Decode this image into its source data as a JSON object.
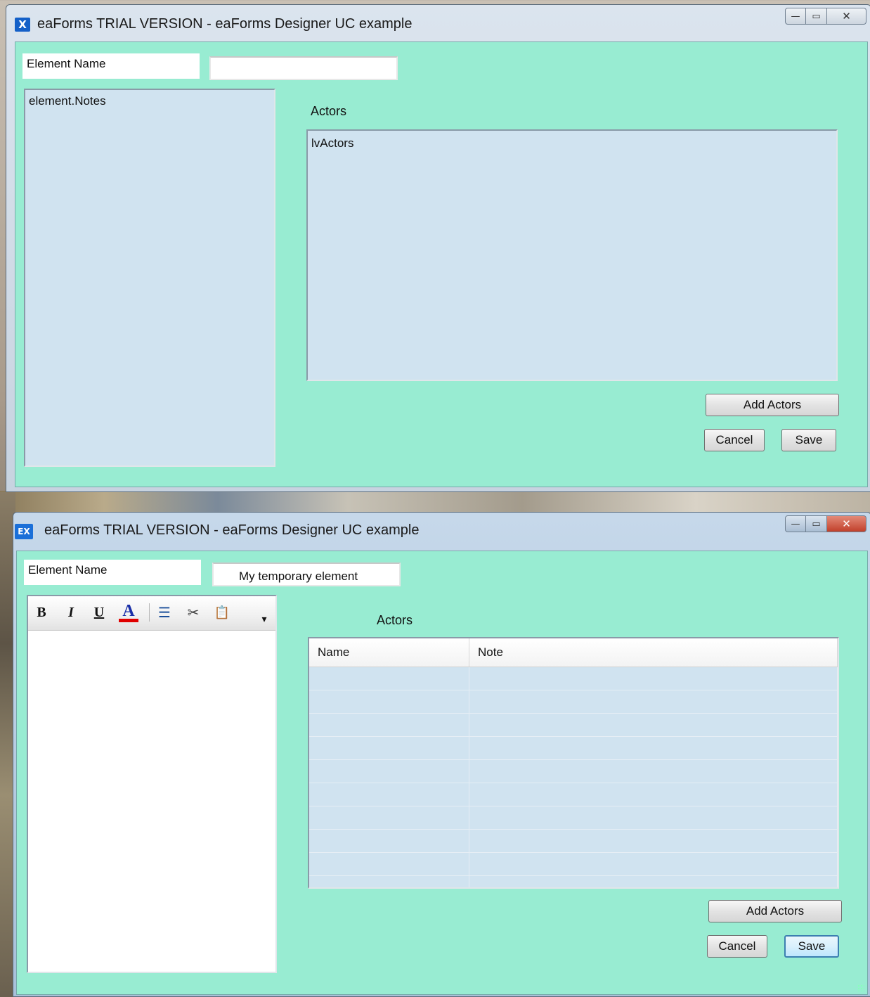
{
  "window1": {
    "title": "eaForms TRIAL VERSION - eaForms Designer UC example",
    "icon_text": "X",
    "caption": {
      "minimize": "—",
      "maximize": "▭",
      "close": "✕"
    },
    "element_name_label": "Element Name",
    "element_name_value": "",
    "notes_text": "element.Notes",
    "actors_label": "Actors",
    "actors_list_text": "lvActors",
    "add_actors_label": "Add Actors",
    "cancel_label": "Cancel",
    "save_label": "Save"
  },
  "window2": {
    "title": "eaForms TRIAL VERSION - eaForms Designer UC example",
    "icon_text": "EX",
    "caption": {
      "minimize": "—",
      "maximize": "▭",
      "close": "✕"
    },
    "element_name_label": "Element Name",
    "element_name_value": "My temporary element",
    "toolbar": {
      "bold": "B",
      "italic": "I",
      "underline": "U",
      "font_color": "A",
      "bullets": "☰",
      "cut": "✂",
      "paste": "📋",
      "overflow": "▾"
    },
    "actors_label": "Actors",
    "table_headers": [
      "Name",
      "Note"
    ],
    "add_actors_label": "Add Actors",
    "cancel_label": "Cancel",
    "save_label": "Save"
  },
  "colors": {
    "client_bg": "#98ecd2",
    "list_bg": "#d0e3f0",
    "font_color_underline": "#e00000",
    "close_button_active": "#c1402b"
  }
}
